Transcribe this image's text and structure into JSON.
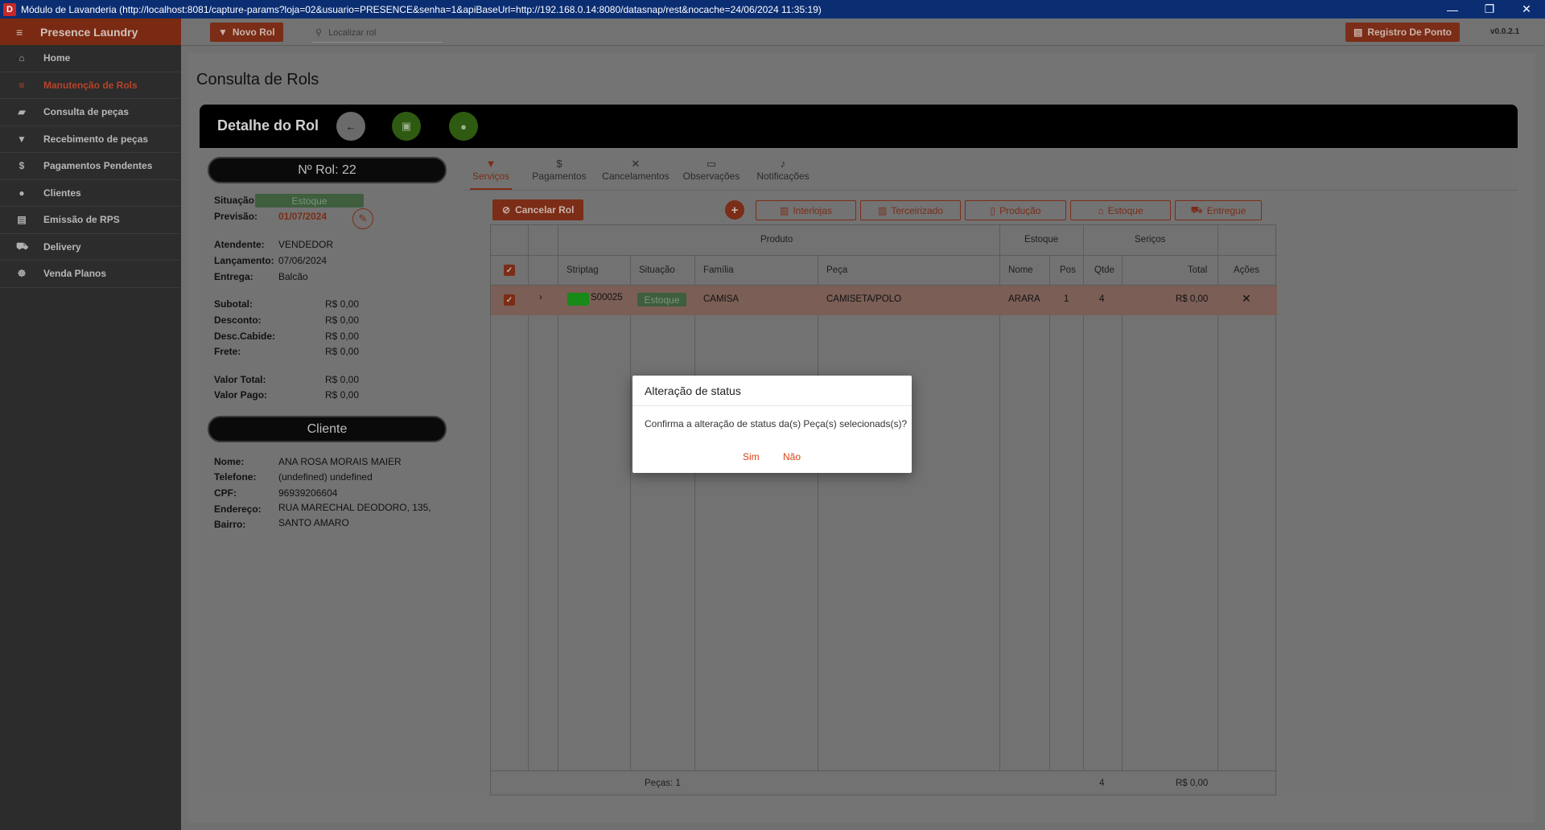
{
  "window": {
    "title": "Módulo de Lavanderia (http://localhost:8081/capture-params?loja=02&usuario=PRESENCE&senha=1&apiBaseUrl=http://192.168.0.14:8080/datasnap/rest&nocache=24/06/2024 11:35:19)",
    "icon_letter": "D"
  },
  "sidebar": {
    "brand": "Presence Laundry",
    "items": [
      {
        "label": "Home",
        "icon": "home-icon",
        "glyph": "⌂"
      },
      {
        "label": "Manutenção de Rols",
        "icon": "tune-icon",
        "glyph": "≡"
      },
      {
        "label": "Consulta de peças",
        "icon": "label-icon",
        "glyph": "▰"
      },
      {
        "label": "Recebimento de peças",
        "icon": "cart-icon",
        "glyph": "🛒"
      },
      {
        "label": "Pagamentos Pendentes",
        "icon": "dollar-icon",
        "glyph": "$"
      },
      {
        "label": "Clientes",
        "icon": "person-icon",
        "glyph": "●"
      },
      {
        "label": "Emissão de RPS",
        "icon": "document-icon",
        "glyph": "▤"
      },
      {
        "label": "Delivery",
        "icon": "truck-icon",
        "glyph": "⛟"
      },
      {
        "label": "Venda Planos",
        "icon": "plan-icon",
        "glyph": "☸"
      }
    ]
  },
  "topbar": {
    "novo_rol": "Novo Rol",
    "search_placeholder": "Localizar rol",
    "registro_ponto": "Registro De Ponto",
    "version": "v0.0.2.1"
  },
  "page": {
    "title": "Consulta de Rols",
    "detail_title": "Detalhe do Rol"
  },
  "rol": {
    "number_label": "Nº Rol: 22",
    "situacao_label": "Situação:",
    "situacao_value": "Estoque",
    "previsao_label": "Previsão:",
    "previsao_value": "01/07/2024",
    "atendente_label": "Atendente:",
    "atendente_value": "VENDEDOR",
    "lancamento_label": "Lançamento:",
    "lancamento_value": "07/06/2024",
    "entrega_label": "Entrega:",
    "entrega_value": "Balcão",
    "subtotal_label": "Subotal:",
    "subtotal_value": "R$ 0,00",
    "desconto_label": "Desconto:",
    "desconto_value": "R$ 0,00",
    "desc_cabide_label": "Desc.Cabide:",
    "desc_cabide_value": "R$ 0,00",
    "frete_label": "Frete:",
    "frete_value": "R$ 0,00",
    "valor_total_label": "Valor Total:",
    "valor_total_value": "R$ 0,00",
    "valor_pago_label": "Valor Pago:",
    "valor_pago_value": "R$ 0,00"
  },
  "cliente": {
    "header": "Cliente",
    "nome_label": "Nome:",
    "nome_value": "ANA ROSA MORAIS MAIER",
    "telefone_label": "Telefone:",
    "telefone_value": "(undefined) undefined",
    "cpf_label": "CPF:",
    "cpf_value": "96939206604",
    "endereco_label": "Endereço:",
    "endereco_value": "RUA MARECHAL DEODORO, 135,",
    "bairro_label": "Bairro:",
    "bairro_value": "SANTO AMARO"
  },
  "tabs": [
    {
      "label": "Serviços",
      "icon": "cart-icon"
    },
    {
      "label": "Pagamentos",
      "icon": "dollar-icon"
    },
    {
      "label": "Cancelamentos",
      "icon": "close-icon"
    },
    {
      "label": "Observações",
      "icon": "comment-icon"
    },
    {
      "label": "Notificações",
      "icon": "bell-icon"
    }
  ],
  "actions": {
    "cancelar_rol": "Cancelar Rol",
    "interlojas": "Interlojas",
    "terceirizado": "Terceirizado",
    "producao": "Produção",
    "estoque": "Estoque",
    "entregue": "Entregue"
  },
  "table": {
    "group_headers": {
      "produto": "Produto",
      "estoque": "Estoque",
      "servicos": "Seriços"
    },
    "columns": [
      "Striptag",
      "Situação",
      "Família",
      "Peça",
      "Nome",
      "Pos",
      "Qtde",
      "Total",
      "Ações"
    ],
    "rows": [
      {
        "striptag": "S00025",
        "situacao": "Estoque",
        "familia": "CAMISA",
        "peca": "CAMISETA/POLO",
        "nome": "ARARA",
        "pos": "1",
        "qtde": "4",
        "total": "R$ 0,00"
      }
    ],
    "footer": {
      "pecas": "Peças: 1",
      "qtde": "4",
      "total": "R$ 0,00"
    }
  },
  "dialog": {
    "title": "Alteração de status",
    "message": "Confirma a alteração de status da(s) Peça(s) selecionads(s)?",
    "yes": "Sim",
    "no": "Não"
  },
  "colors": {
    "accent": "#d84315",
    "sidebar": "#2c2c2c",
    "status_green": "#66bb6a",
    "row_highlight": "#f3c6b8"
  }
}
